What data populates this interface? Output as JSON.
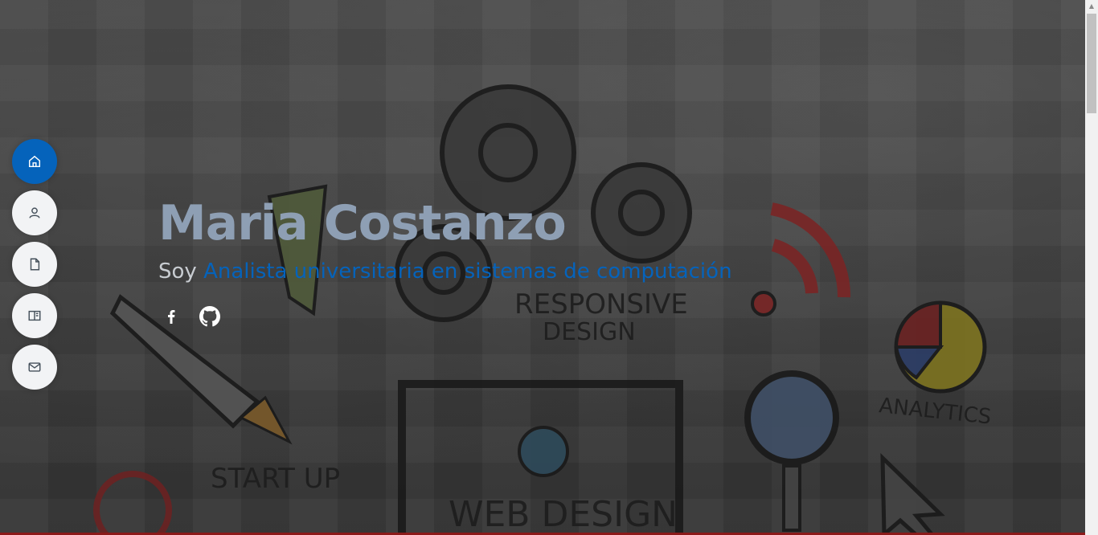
{
  "hero": {
    "name": "Maria Costanzo",
    "prefix": "Soy",
    "role": "Analista universitaria en sistemas de computación"
  },
  "nav": {
    "items": [
      {
        "icon": "home-icon",
        "active": true
      },
      {
        "icon": "person-icon",
        "active": false
      },
      {
        "icon": "document-icon",
        "active": false
      },
      {
        "icon": "book-icon",
        "active": false
      },
      {
        "icon": "envelope-icon",
        "active": false
      }
    ]
  },
  "social": [
    {
      "icon": "facebook-icon"
    },
    {
      "icon": "github-icon"
    }
  ],
  "background_words": [
    "RESPONSIVE",
    "DESIGN",
    "ANALYTICS",
    "START UP",
    "WEB DESIGN"
  ],
  "colors": {
    "accent": "#0563bb",
    "name": "#8e9fb4",
    "nav_bg": "#f2f3f5"
  }
}
